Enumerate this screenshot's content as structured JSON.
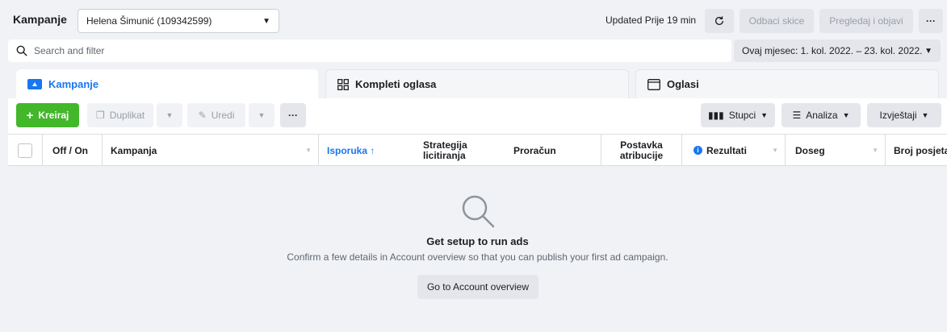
{
  "header": {
    "title": "Kampanje",
    "account": "Helena Šimunić (109342599)",
    "updated": "Updated Prije 19 min",
    "discard_label": "Odbaci skice",
    "review_label": "Pregledaj i objavi",
    "more_label": "···"
  },
  "search": {
    "placeholder": "Search and filter",
    "date_range": "Ovaj mjesec: 1. kol. 2022. – 23. kol. 2022."
  },
  "tabs": [
    {
      "label": "Kampanje",
      "active": true
    },
    {
      "label": "Kompleti oglasa",
      "active": false
    },
    {
      "label": "Oglasi",
      "active": false
    }
  ],
  "toolbar": {
    "create_label": "Kreiraj",
    "duplicate_label": "Duplikat",
    "edit_label": "Uredi",
    "more_label": "···",
    "columns_label": "Stupci",
    "breakdown_label": "Analiza",
    "reports_label": "Izvještaji"
  },
  "table": {
    "columns": {
      "toggle": "Off / On",
      "campaign": "Kampanja",
      "delivery": "Isporuka ↑",
      "bid_strategy_1": "Strategija",
      "bid_strategy_2": "licitiranja",
      "budget": "Proračun",
      "attribution_1": "Postavka",
      "attribution_2": "atribucije",
      "results": "Rezultati",
      "reach": "Doseg",
      "visits": "Broj posjeta"
    }
  },
  "empty_state": {
    "title": "Get setup to run ads",
    "subtitle": "Confirm a few details in Account overview so that you can publish your first ad campaign.",
    "button_label": "Go to Account overview"
  },
  "colors": {
    "accent": "#1877f2",
    "create": "#42b72a"
  }
}
